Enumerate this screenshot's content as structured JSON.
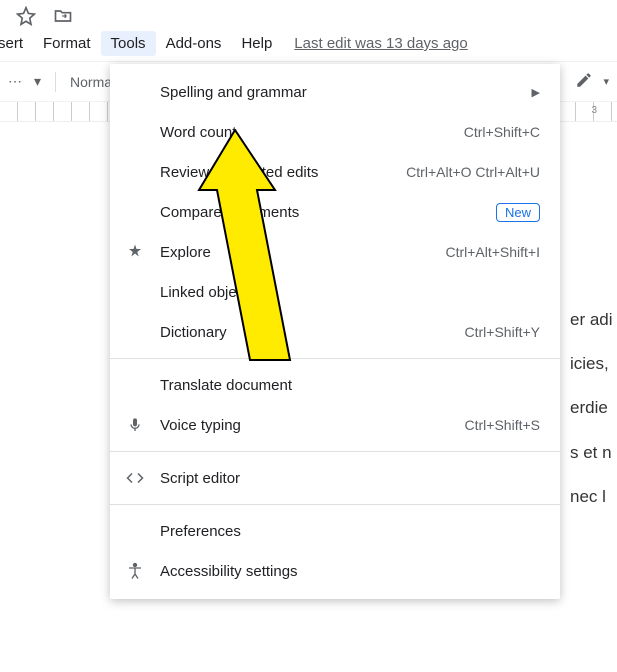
{
  "top_icons": {
    "star": "star-outline-icon",
    "move": "folder-move-icon"
  },
  "menubar": {
    "items": [
      {
        "label": "sert"
      },
      {
        "label": "Format"
      },
      {
        "label": "Tools",
        "active": true
      },
      {
        "label": "Add-ons"
      },
      {
        "label": "Help"
      }
    ],
    "last_edit": "Last edit was 13 days ago"
  },
  "toolbar": {
    "dots": "⋯",
    "style_label": "Normal",
    "caret": "▾",
    "edit_icon": "edit-pencil-icon",
    "down_icon": "chevron-down-icon"
  },
  "ruler": {
    "num_right": "3"
  },
  "document": {
    "lines": [
      "er adi",
      "icies,",
      "erdie",
      "s et n",
      "nec l"
    ]
  },
  "tools_menu": {
    "items": [
      {
        "icon": "",
        "label": "Spelling and grammar",
        "shortcut": "",
        "submenu": true
      },
      {
        "icon": "",
        "label": "Word count",
        "shortcut": "Ctrl+Shift+C"
      },
      {
        "icon": "",
        "label": "Review suggested edits",
        "shortcut": "Ctrl+Alt+O Ctrl+Alt+U"
      },
      {
        "icon": "",
        "label": "Compare documents",
        "shortcut": "",
        "badge": "New"
      },
      {
        "icon": "explore",
        "label": "Explore",
        "shortcut": "Ctrl+Alt+Shift+I"
      },
      {
        "icon": "",
        "label": "Linked objects",
        "shortcut": ""
      },
      {
        "icon": "",
        "label": "Dictionary",
        "shortcut": "Ctrl+Shift+Y"
      },
      {
        "separator": true
      },
      {
        "icon": "",
        "label": "Translate document",
        "shortcut": ""
      },
      {
        "icon": "mic",
        "label": "Voice typing",
        "shortcut": "Ctrl+Shift+S"
      },
      {
        "separator": true
      },
      {
        "icon": "code",
        "label": "Script editor",
        "shortcut": ""
      },
      {
        "separator": true
      },
      {
        "icon": "",
        "label": "Preferences",
        "shortcut": ""
      },
      {
        "icon": "accessibility",
        "label": "Accessibility settings",
        "shortcut": ""
      }
    ]
  }
}
